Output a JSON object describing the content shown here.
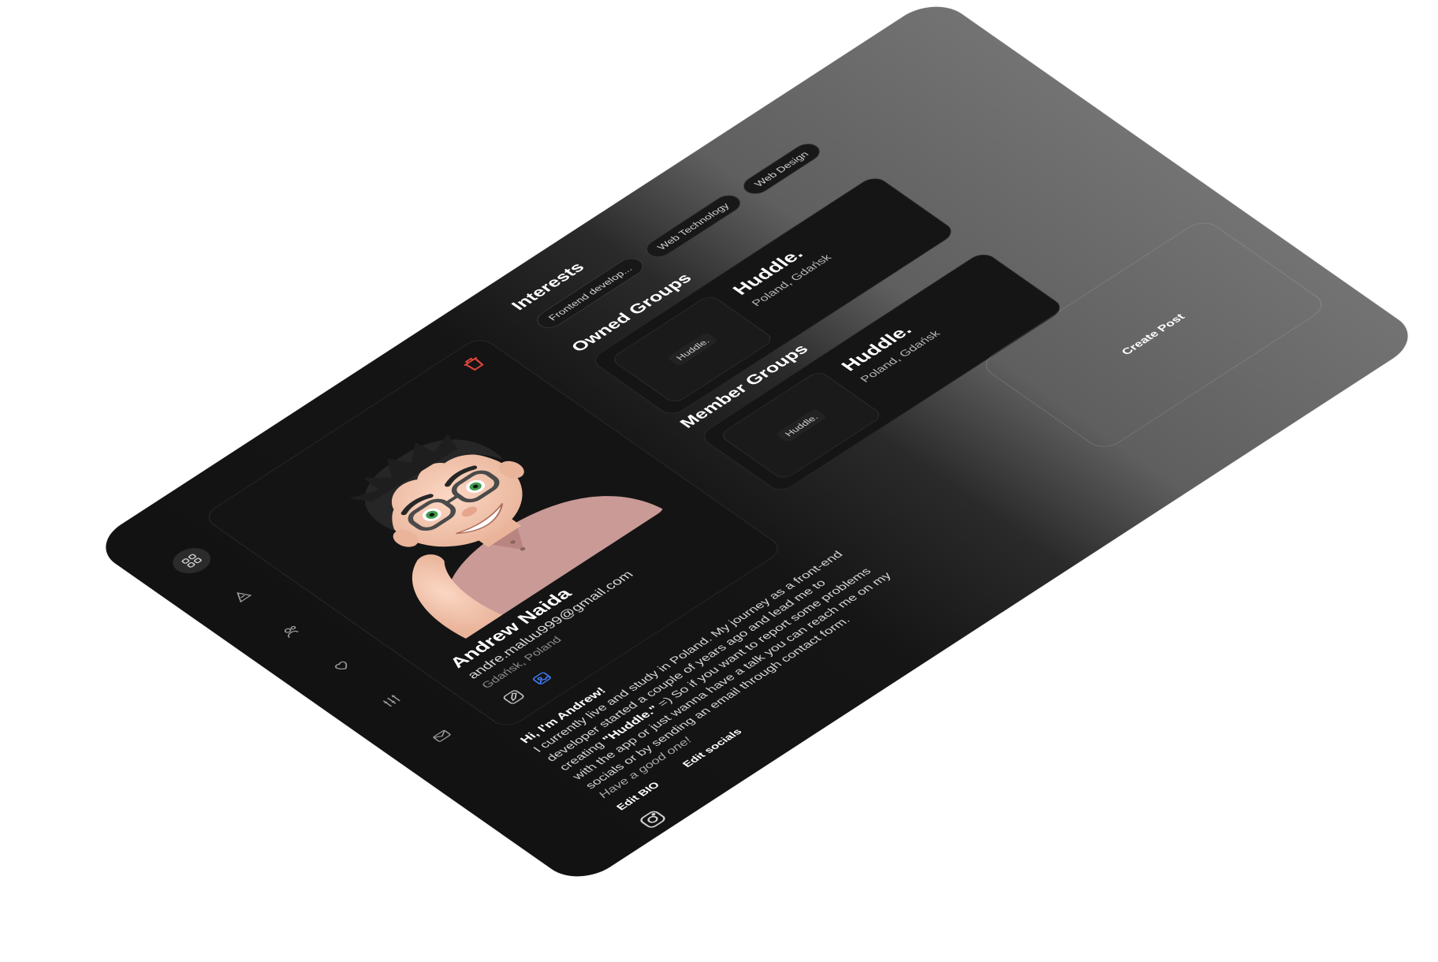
{
  "profile": {
    "name": "Andrew Naida",
    "email": "andre.maluu999@gmail.com",
    "location": "Gdańsk, Poland"
  },
  "bio": {
    "greeting": "Hi, I'm Andrew!",
    "text_1": "I currently live and study in Poland. My journey as a front-end developer started a couple of years ago and lead me to creating",
    "brand": "\"Huddle.\"",
    "text_2": "=) So if you want to report some problems with the app or just wanna have a talk you can reach me on my socials or by sending an email through contact form.",
    "signoff": "Have a good one!",
    "edit_bio_label": "Edit BIO",
    "edit_socials_label": "Edit socials"
  },
  "interests": {
    "title": "Interests",
    "items": [
      "Frontend develop...",
      "Web Technology",
      "Web Design"
    ]
  },
  "owned_groups": {
    "title": "Owned Groups",
    "items": [
      {
        "thumb": "Huddle.",
        "name": "Huddle.",
        "location": "Poland, Gdańsk"
      }
    ]
  },
  "member_groups": {
    "title": "Member Groups",
    "items": [
      {
        "thumb": "Huddle.",
        "name": "Huddle.",
        "location": "Poland, Gdańsk"
      }
    ]
  },
  "create_post": {
    "label": "Create Post"
  },
  "icons": {
    "sidebar": [
      "dashboard-icon",
      "explore-icon",
      "friends-icon",
      "heart-icon",
      "settings-sliders-icon",
      "mail-icon"
    ],
    "delete": "trash-icon",
    "edit_profile": "edit-icon",
    "edit_photo": "image-edit-icon",
    "social": "instagram-icon"
  },
  "colors": {
    "accent_blue": "#3d7bf0",
    "danger_red": "#e0453e",
    "panel_dark": "#141414"
  }
}
